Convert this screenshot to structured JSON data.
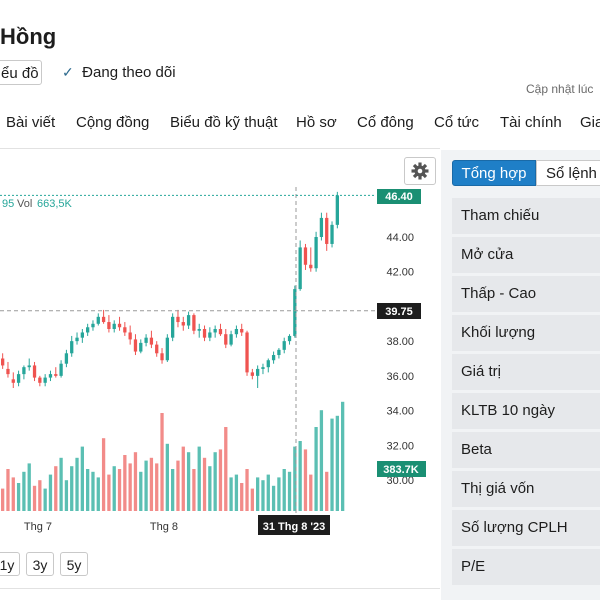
{
  "header": {
    "title": "Hồng",
    "chart_button_label": "ểu đồ",
    "follow_label": "Đang theo dõi",
    "updated_label": "Cập nhật lúc"
  },
  "tabs": [
    "Bài viết",
    "Cộng đồng",
    "Biểu đồ kỹ thuật",
    "Hồ sơ",
    "Cổ đông",
    "Cổ tức",
    "Tài chính",
    "Gia"
  ],
  "chart": {
    "legend": {
      "value_fragment": "95",
      "vol_label": "Vol",
      "vol_value": "663,5K"
    },
    "last_price_tag": "46.40",
    "crosshair_price_tag": "39.75",
    "volume_tag": "383.7K",
    "date_tag": "31 Thg 8 '23",
    "x_tick_labels": [
      "Thg 7",
      "Thg 8"
    ],
    "y_tick_labels": [
      "44.00",
      "42.00",
      "40.00",
      "38.00",
      "36.00",
      "34.00",
      "32.00",
      "30.00"
    ],
    "up_color": "#26a69a",
    "down_color": "#ef5350"
  },
  "range_buttons": [
    "1y",
    "3y",
    "5y"
  ],
  "panel": {
    "tabs": {
      "active": "Tổng hợp",
      "inactive": "Sổ lệnh"
    },
    "rows": [
      "Tham chiếu",
      "Mở cửa",
      "Thấp - Cao",
      "Khối lượng",
      "Giá trị",
      "KLTB 10 ngày",
      "Beta",
      "Thị giá vốn",
      "Số lượng CPLH",
      "P/E"
    ]
  },
  "chart_data": {
    "type": "candlestick",
    "y_range": [
      29,
      47
    ],
    "candles": [
      {
        "o": 37.0,
        "h": 37.3,
        "l": 36.4,
        "c": 36.6
      },
      {
        "o": 36.4,
        "h": 36.8,
        "l": 35.9,
        "c": 36.1
      },
      {
        "o": 35.8,
        "h": 36.2,
        "l": 35.3,
        "c": 35.6
      },
      {
        "o": 35.6,
        "h": 36.3,
        "l": 35.4,
        "c": 36.1
      },
      {
        "o": 36.1,
        "h": 36.6,
        "l": 35.8,
        "c": 36.5
      },
      {
        "o": 36.5,
        "h": 37.0,
        "l": 36.3,
        "c": 36.6
      },
      {
        "o": 36.6,
        "h": 36.8,
        "l": 35.7,
        "c": 35.9
      },
      {
        "o": 35.9,
        "h": 36.0,
        "l": 35.4,
        "c": 35.6
      },
      {
        "o": 35.6,
        "h": 36.1,
        "l": 35.4,
        "c": 35.9
      },
      {
        "o": 35.9,
        "h": 36.3,
        "l": 35.7,
        "c": 36.1
      },
      {
        "o": 36.1,
        "h": 36.5,
        "l": 35.9,
        "c": 36.0
      },
      {
        "o": 36.0,
        "h": 36.9,
        "l": 35.9,
        "c": 36.7
      },
      {
        "o": 36.7,
        "h": 37.5,
        "l": 36.5,
        "c": 37.3
      },
      {
        "o": 37.3,
        "h": 38.3,
        "l": 37.1,
        "c": 38.0
      },
      {
        "o": 38.0,
        "h": 38.5,
        "l": 37.8,
        "c": 38.2
      },
      {
        "o": 38.2,
        "h": 38.7,
        "l": 37.9,
        "c": 38.5
      },
      {
        "o": 38.5,
        "h": 39.0,
        "l": 38.3,
        "c": 38.8
      },
      {
        "o": 38.8,
        "h": 39.2,
        "l": 38.6,
        "c": 39.0
      },
      {
        "o": 39.0,
        "h": 39.6,
        "l": 38.9,
        "c": 39.4
      },
      {
        "o": 39.4,
        "h": 39.8,
        "l": 39.0,
        "c": 39.1
      },
      {
        "o": 39.1,
        "h": 39.5,
        "l": 38.5,
        "c": 38.7
      },
      {
        "o": 38.7,
        "h": 39.2,
        "l": 38.5,
        "c": 39.0
      },
      {
        "o": 39.0,
        "h": 39.4,
        "l": 38.6,
        "c": 38.8
      },
      {
        "o": 38.8,
        "h": 39.1,
        "l": 38.3,
        "c": 38.5
      },
      {
        "o": 38.5,
        "h": 38.9,
        "l": 37.8,
        "c": 38.1
      },
      {
        "o": 38.1,
        "h": 38.4,
        "l": 37.2,
        "c": 37.4
      },
      {
        "o": 37.4,
        "h": 38.1,
        "l": 37.3,
        "c": 37.9
      },
      {
        "o": 37.9,
        "h": 38.4,
        "l": 37.7,
        "c": 38.2
      },
      {
        "o": 38.2,
        "h": 38.6,
        "l": 37.6,
        "c": 37.8
      },
      {
        "o": 37.8,
        "h": 38.0,
        "l": 37.1,
        "c": 37.3
      },
      {
        "o": 37.3,
        "h": 37.6,
        "l": 36.7,
        "c": 36.9
      },
      {
        "o": 36.9,
        "h": 38.4,
        "l": 36.8,
        "c": 38.2
      },
      {
        "o": 38.2,
        "h": 39.6,
        "l": 38.0,
        "c": 39.4
      },
      {
        "o": 39.4,
        "h": 39.8,
        "l": 38.8,
        "c": 39.1
      },
      {
        "o": 39.1,
        "h": 39.4,
        "l": 38.6,
        "c": 38.9
      },
      {
        "o": 38.9,
        "h": 39.7,
        "l": 38.7,
        "c": 39.5
      },
      {
        "o": 39.5,
        "h": 39.6,
        "l": 38.4,
        "c": 38.6
      },
      {
        "o": 38.6,
        "h": 39.0,
        "l": 38.2,
        "c": 38.7
      },
      {
        "o": 38.7,
        "h": 38.9,
        "l": 38.0,
        "c": 38.2
      },
      {
        "o": 38.2,
        "h": 38.8,
        "l": 38.0,
        "c": 38.5
      },
      {
        "o": 38.5,
        "h": 38.9,
        "l": 38.2,
        "c": 38.7
      },
      {
        "o": 38.7,
        "h": 39.0,
        "l": 38.3,
        "c": 38.4
      },
      {
        "o": 38.4,
        "h": 38.7,
        "l": 37.6,
        "c": 37.8
      },
      {
        "o": 37.8,
        "h": 38.6,
        "l": 37.7,
        "c": 38.4
      },
      {
        "o": 38.4,
        "h": 38.9,
        "l": 38.2,
        "c": 38.7
      },
      {
        "o": 38.7,
        "h": 39.0,
        "l": 38.3,
        "c": 38.5
      },
      {
        "o": 38.5,
        "h": 38.6,
        "l": 36.0,
        "c": 36.2
      },
      {
        "o": 36.2,
        "h": 36.4,
        "l": 35.8,
        "c": 36.0
      },
      {
        "o": 36.0,
        "h": 36.6,
        "l": 35.3,
        "c": 36.4
      },
      {
        "o": 36.4,
        "h": 36.7,
        "l": 36.1,
        "c": 36.5
      },
      {
        "o": 36.5,
        "h": 37.0,
        "l": 36.2,
        "c": 36.9
      },
      {
        "o": 36.9,
        "h": 37.4,
        "l": 36.7,
        "c": 37.2
      },
      {
        "o": 37.2,
        "h": 37.6,
        "l": 37.0,
        "c": 37.5
      },
      {
        "o": 37.5,
        "h": 38.2,
        "l": 37.3,
        "c": 38.0
      },
      {
        "o": 38.0,
        "h": 38.4,
        "l": 37.8,
        "c": 38.3
      },
      {
        "o": 38.3,
        "h": 41.2,
        "l": 38.2,
        "c": 41.0
      },
      {
        "o": 41.0,
        "h": 43.8,
        "l": 40.9,
        "c": 43.4
      },
      {
        "o": 43.4,
        "h": 43.6,
        "l": 42.1,
        "c": 42.4
      },
      {
        "o": 42.4,
        "h": 43.4,
        "l": 42.0,
        "c": 42.2
      },
      {
        "o": 42.2,
        "h": 44.3,
        "l": 42.0,
        "c": 44.0
      },
      {
        "o": 44.0,
        "h": 45.4,
        "l": 43.8,
        "c": 45.1
      },
      {
        "o": 45.1,
        "h": 45.4,
        "l": 43.2,
        "c": 43.6
      },
      {
        "o": 43.6,
        "h": 44.9,
        "l": 43.4,
        "c": 44.7
      },
      {
        "o": 44.7,
        "h": 46.6,
        "l": 44.5,
        "c": 46.4
      }
    ],
    "volumes": [
      80,
      150,
      120,
      100,
      140,
      170,
      90,
      110,
      80,
      130,
      160,
      190,
      110,
      160,
      190,
      230,
      150,
      140,
      120,
      260,
      130,
      160,
      150,
      200,
      170,
      210,
      140,
      180,
      190,
      170,
      350,
      240,
      150,
      180,
      230,
      210,
      150,
      230,
      190,
      160,
      210,
      220,
      300,
      120,
      130,
      100,
      150,
      80,
      120,
      110,
      130,
      90,
      120,
      150,
      140,
      230,
      250,
      220,
      130,
      300,
      360,
      140,
      330,
      340,
      390
    ]
  }
}
